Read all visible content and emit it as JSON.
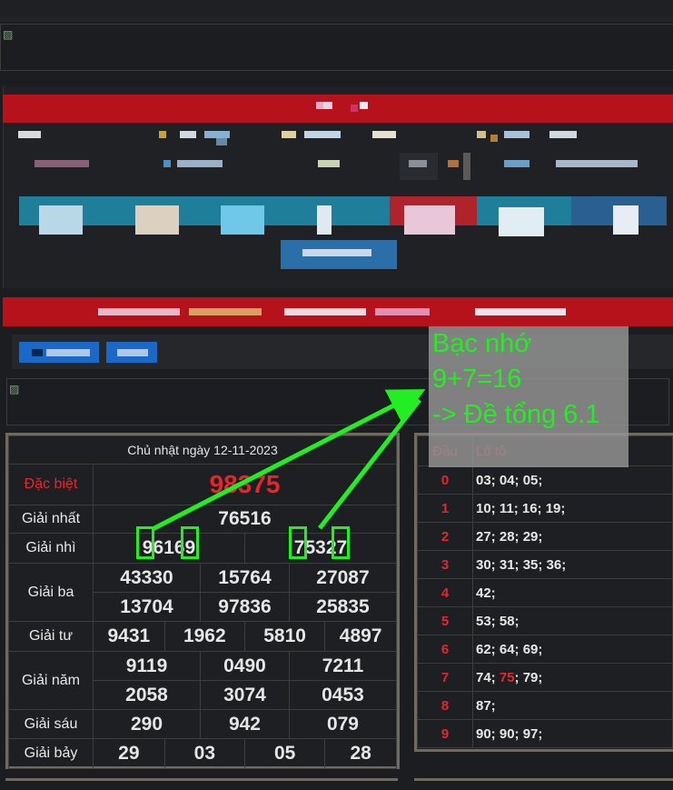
{
  "results": {
    "date": "Chủ nhật ngày 12-11-2023",
    "rows": [
      {
        "label": "Đặc biệt",
        "values": [
          "98375"
        ]
      },
      {
        "label": "Giải nhất",
        "values": [
          "76516"
        ]
      },
      {
        "label": "Giải nhì",
        "values": [
          "96169",
          "75327"
        ]
      },
      {
        "label": "Giải ba",
        "values": [
          "43330",
          "15764",
          "27087",
          "13704",
          "97836",
          "25835"
        ]
      },
      {
        "label": "Giải tư",
        "values": [
          "9431",
          "1962",
          "5810",
          "4897"
        ]
      },
      {
        "label": "Giải năm",
        "values": [
          "9119",
          "0490",
          "7211",
          "2058",
          "3074",
          "0453"
        ]
      },
      {
        "label": "Giải sáu",
        "values": [
          "290",
          "942",
          "079"
        ]
      },
      {
        "label": "Giải bảy",
        "values": [
          "29",
          "03",
          "05",
          "28"
        ]
      }
    ]
  },
  "loto": {
    "head_label": "Đầu",
    "value_label": "Lô tô",
    "rows": [
      {
        "head": "0",
        "values": "03; 04; 05;"
      },
      {
        "head": "1",
        "values": "10; 11; 16; 19;"
      },
      {
        "head": "2",
        "values": "27; 28; 29;"
      },
      {
        "head": "3",
        "values": "30; 31; 35; 36;"
      },
      {
        "head": "4",
        "values": "42;"
      },
      {
        "head": "5",
        "values": "53; 58;"
      },
      {
        "head": "6",
        "values": "62; 64; 69;"
      },
      {
        "head": "7",
        "values_before": "74; ",
        "highlight": "75",
        "values_after": "; 79;"
      },
      {
        "head": "8",
        "values": "87;"
      },
      {
        "head": "9",
        "values": "90; 90; 97;"
      }
    ]
  },
  "annotation": {
    "line1": "Bạc nhớ",
    "line2": "9+7=16",
    "line3": "-> Đề tổng 6.1"
  },
  "colors": {
    "accent_red": "#e4262d",
    "banner_red": "#b5121b",
    "annotation_green": "#22ee22",
    "nav_teal": "#1f7e9a"
  }
}
